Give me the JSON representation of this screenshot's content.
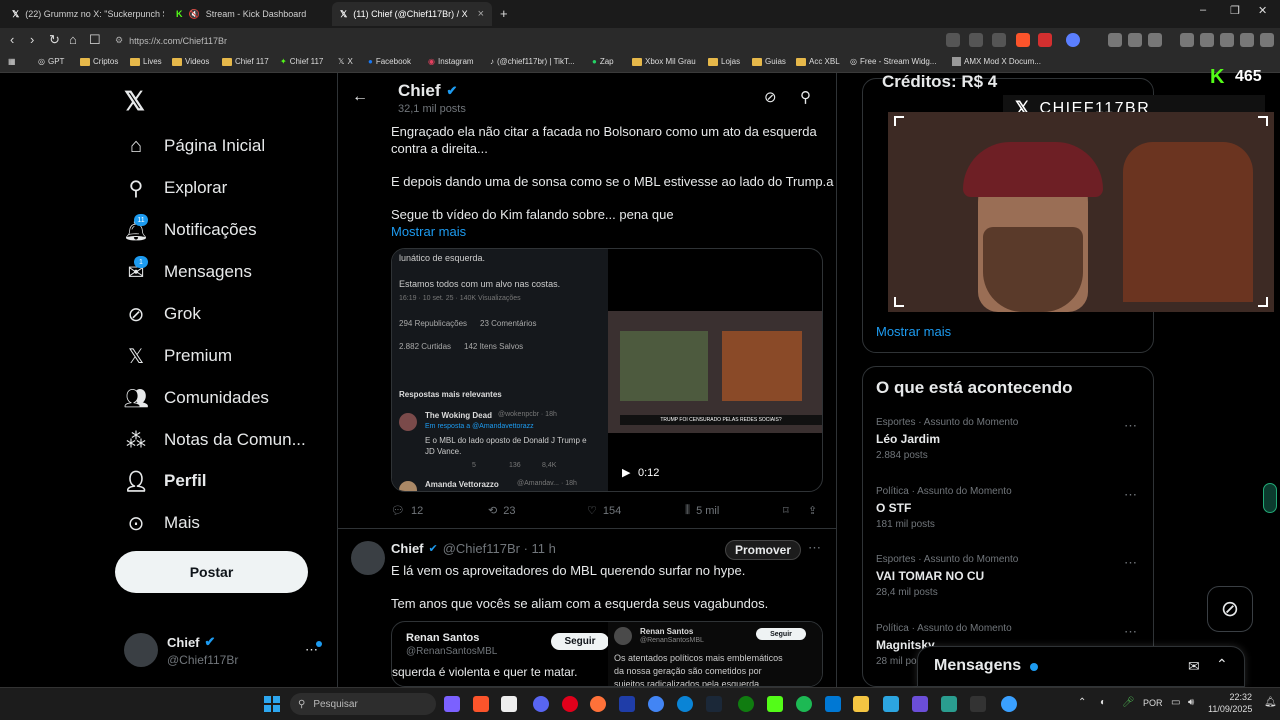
{
  "browser": {
    "tabs": [
      {
        "title": "(22) Grummz no X: \"Suckerpunch Se"
      },
      {
        "title": "Stream - Kick Dashboard"
      },
      {
        "title": "(11) Chief (@Chief117Br) / X"
      }
    ],
    "url": "https://x.com/Chief117Br",
    "bookmarks": [
      "GPT",
      "Criptos",
      "Lives",
      "Videos",
      "Chief 117",
      "Chief 117",
      "X",
      "Facebook",
      "Instagram",
      "(@chief117br) | TikT...",
      "Zap",
      "Xbox Mil Grau",
      "Lojas",
      "Guias",
      "Acc XBL",
      "Free - Stream Widg...",
      "AMX Mod X Docum..."
    ]
  },
  "sidebar": {
    "items": [
      {
        "label": "Página Inicial"
      },
      {
        "label": "Explorar"
      },
      {
        "label": "Notificações",
        "badge": "11"
      },
      {
        "label": "Mensagens",
        "badge": "1"
      },
      {
        "label": "Grok"
      },
      {
        "label": "Premium"
      },
      {
        "label": "Comunidades"
      },
      {
        "label": "Notas da Comun..."
      },
      {
        "label": "Perfil"
      },
      {
        "label": "Mais"
      }
    ],
    "post_button": "Postar",
    "account": {
      "name": "Chief",
      "handle": "@Chief117Br"
    }
  },
  "header": {
    "name": "Chief",
    "posts": "32,1 mil posts"
  },
  "tweet1": {
    "line1": "Engraçado ela não citar a facada no Bolsonaro como um ato da esquerda",
    "line2": "contra a direita...",
    "line3": "E depois dando uma de sonsa como se o MBL estivesse ao lado do Trump.a",
    "line4": "Segue tb vídeo do Kim falando sobre... pena que",
    "show_more": "Mostrar mais",
    "embed": {
      "t1": "lunático de esquerda.",
      "t2": "Estamos todos com um alvo nas costas.",
      "meta": "16:19 · 10 set. 25 · 140K Visualizações",
      "r1a": "294 Republicações",
      "r1b": "23 Comentários",
      "r2a": "2.882 Curtidas",
      "r2b": "142 Itens Salvos",
      "replies_header": "Respostas mais relevantes",
      "reply1_name": "The Woking Dead",
      "reply1_handle": "@wokenpcbr · 18h",
      "reply1_to": "Em resposta a @Amandavettorazz",
      "reply1_text1": "E o MBL do lado oposto de Donald J Trump e",
      "reply1_text2": "JD Vance.",
      "reply1_stats": [
        "5",
        "136",
        "8,4K"
      ],
      "reply2_name": "Amanda Vettorazzo",
      "reply2_handle": "@Amandav... · 18h",
      "video_caption": "TRUMP FOI CENSURADO PELAS REDES SOCIAIS?",
      "video_time": "0:12"
    },
    "actions": {
      "replies": "12",
      "reposts": "23",
      "likes": "154",
      "views": "5 mil"
    }
  },
  "tweet2": {
    "name": "Chief",
    "handle": "@Chief117Br · 11 h",
    "promote": "Promover",
    "line1": "E lá vem os aproveitadores do MBL querendo surfar no hype.",
    "line2": "Tem anos que vocês se aliam com a esquerda seus vagabundos.",
    "quote_left": {
      "name": "Renan Santos",
      "handle": "@RenanSantosMBL",
      "follow": "Seguir",
      "text": "squerda é violenta e quer te matar."
    },
    "quote_right": {
      "name": "Renan Santos",
      "handle": "@RenanSantosMBL",
      "follow": "Seguir",
      "text1": "Os atentados políticos mais emblemáticos",
      "text2": "da nossa geração são cometidos por",
      "text3": "sujeitos radicalizados pela esquerda."
    }
  },
  "right": {
    "show_more": "Mostrar mais",
    "trends_title": "O que está acontecendo",
    "trends": [
      {
        "cat": "Esportes · Assunto do Momento",
        "title": "Léo Jardim",
        "count": "2.884 posts"
      },
      {
        "cat": "Política · Assunto do Momento",
        "title": "O STF",
        "count": "181 mil posts"
      },
      {
        "cat": "Esportes · Assunto do Momento",
        "title": "VAI TOMAR NO CU",
        "count": "28,4 mil posts"
      },
      {
        "cat": "Política · Assunto do Momento",
        "title": "Magnitsky",
        "count": "28 mil posts"
      }
    ],
    "messages": "Mensagens"
  },
  "overlay": {
    "credits": "Créditos: R$ 4",
    "kick_count": "465",
    "channel": "CHIEF117BR"
  },
  "taskbar": {
    "search": "Pesquisar",
    "lang": "POR",
    "time": "22:32",
    "date": "11/09/2025"
  }
}
